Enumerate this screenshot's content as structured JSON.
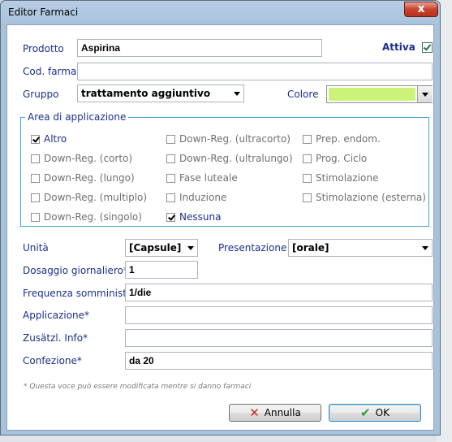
{
  "window": {
    "title": "Editor Farmaci",
    "close_symbol": "x"
  },
  "form": {
    "prodotto_label": "Prodotto",
    "prodotto_value": "Aspirina",
    "attiva_label": "Attiva",
    "attiva_checked": true,
    "cod_label": "Cod. farmac",
    "cod_value": "",
    "gruppo_label": "Gruppo",
    "gruppo_value": "trattamento aggiuntivo",
    "colore_label": "Colore",
    "colore_value": "#ccf27a",
    "area_title": "Area di applicazione",
    "area_items": [
      {
        "label": "Altro",
        "checked": true,
        "style": "dark"
      },
      {
        "label": "Down-Reg. (ultracorto)",
        "checked": false,
        "style": "gray"
      },
      {
        "label": "Prep. endom.",
        "checked": false,
        "style": "gray"
      },
      {
        "label": "Down-Reg. (corto)",
        "checked": false,
        "style": "gray"
      },
      {
        "label": "Down-Reg. (ultralungo)",
        "checked": false,
        "style": "gray"
      },
      {
        "label": "Prog. Ciclo",
        "checked": false,
        "style": "gray"
      },
      {
        "label": "Down-Reg. (lungo)",
        "checked": false,
        "style": "gray"
      },
      {
        "label": "Fase luteale",
        "checked": false,
        "style": "gray"
      },
      {
        "label": "Stimolazione",
        "checked": false,
        "style": "gray"
      },
      {
        "label": "Down-Reg. (multiplo)",
        "checked": false,
        "style": "gray"
      },
      {
        "label": "Induzione",
        "checked": false,
        "style": "gray"
      },
      {
        "label": "Stimolazione (esterna)",
        "checked": false,
        "style": "gray"
      },
      {
        "label": "Down-Reg. (singolo)",
        "checked": false,
        "style": "gray"
      },
      {
        "label": "Nessuna",
        "checked": true,
        "style": "dark"
      }
    ],
    "unita_label": "Unità",
    "unita_value": "[Capsule]",
    "presentazione_label": "Presentazione",
    "presentazione_value": "[orale]",
    "dosaggio_label": "Dosaggio giornaliero*",
    "dosaggio_value": "1",
    "frequenza_label": "Frequenza somministr.",
    "frequenza_value": "1/die",
    "applicazione_label": "Applicazione*",
    "applicazione_value": "",
    "zusatzl_label": "Zusätzl. Info*",
    "zusatzl_value": "",
    "confezione_label": "Confezione*",
    "confezione_value": "da 20",
    "footnote": "* Questa voce può essere modificata mentre si danno farmaci"
  },
  "buttons": {
    "annulla": "Annulla",
    "ok": "OK"
  }
}
